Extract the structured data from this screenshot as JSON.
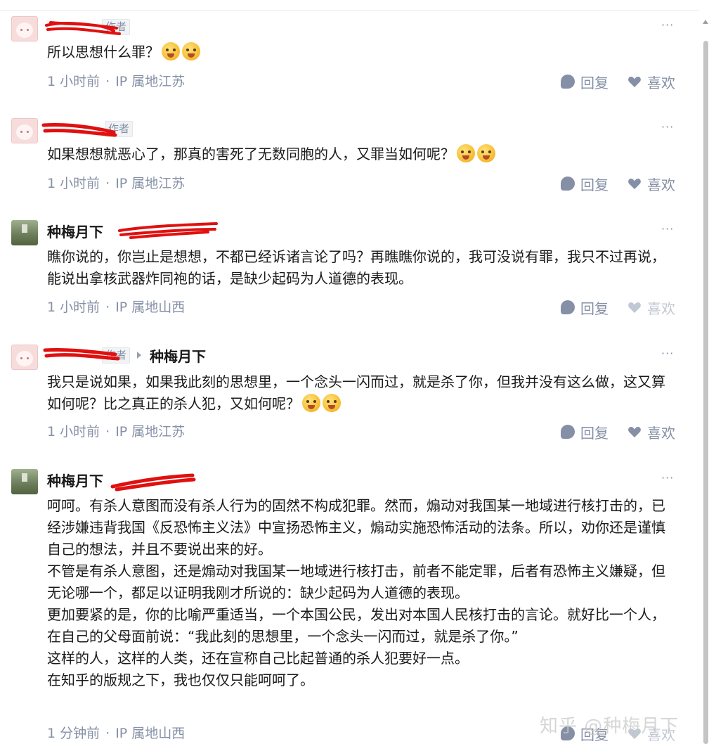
{
  "comments": [
    {
      "author": "",
      "author_tag": "作者",
      "reply_to": "",
      "text": "所以思想什么罪？",
      "emoji_count": 2,
      "time": "1 小时前",
      "ip": "IP 属地江苏",
      "reply_label": "回复",
      "like_label": "喜欢"
    },
    {
      "author": "",
      "author_tag": "作者",
      "reply_to": "",
      "text": "如果想想就恶心了，那真的害死了无数同胞的人，又罪当如何呢？",
      "emoji_count": 2,
      "time": "1 小时前",
      "ip": "IP 属地江苏",
      "reply_label": "回复",
      "like_label": "喜欢"
    },
    {
      "author": "种梅月下",
      "author_tag": "",
      "reply_to": "",
      "text": "瞧你说的，你岂止是想想，不都已经诉诸言论了吗？再瞧瞧你说的，我可没说有罪，我只不过再说，能说出拿核武器炸同袍的话，是缺少起码为人道德的表现。",
      "emoji_count": 0,
      "time": "1 小时前",
      "ip": "IP 属地山西",
      "reply_label": "回复",
      "like_label": "喜欢"
    },
    {
      "author": "",
      "author_tag": "作者",
      "reply_to": "种梅月下",
      "text": "我只是说如果，如果我此刻的思想里，一个念头一闪而过，就是杀了你，但我并没有这么做，这又算如何呢？比之真正的杀人犯，又如何呢？",
      "emoji_count": 2,
      "time": "1 小时前",
      "ip": "IP 属地江苏",
      "reply_label": "回复",
      "like_label": "喜欢"
    },
    {
      "author": "种梅月下",
      "author_tag": "",
      "reply_to": "",
      "text": "呵呵。有杀人意图而没有杀人行为的固然不构成犯罪。然而，煽动对我国某一地域进行核打击的，已经涉嫌违背我国《反恐怖主义法》中宣扬恐怖主义，煽动实施恐怖活动的法条。所以，劝你还是谨慎自己的想法，并且不要说出来的好。\n不管是有杀人意图，还是煽动对我国某一地域进行核打击，前者不能定罪，后者有恐怖主义嫌疑，但无论哪一个，都足以证明我刚才所说的：缺少起码为人道德的表现。\n更加要紧的是，你的比喻严重适当，一个本国公民，发出对本国人民核打击的言论。就好比一个人，在自己的父母面前说：“我此刻的思想里，一个念头一闪而过，就是杀了你。”\n这样的人，这样的人类，还在宣称自己比起普通的杀人犯要好一点。\n在知乎的版规之下，我也仅仅只能呵呵了。",
      "emoji_count": 0,
      "time": "1 分钟前",
      "ip": "IP 属地山西",
      "reply_label": "回复",
      "like_label": "喜欢"
    }
  ],
  "more_label": "···",
  "meta_separator": "·",
  "watermark": "知乎 @种梅月下"
}
